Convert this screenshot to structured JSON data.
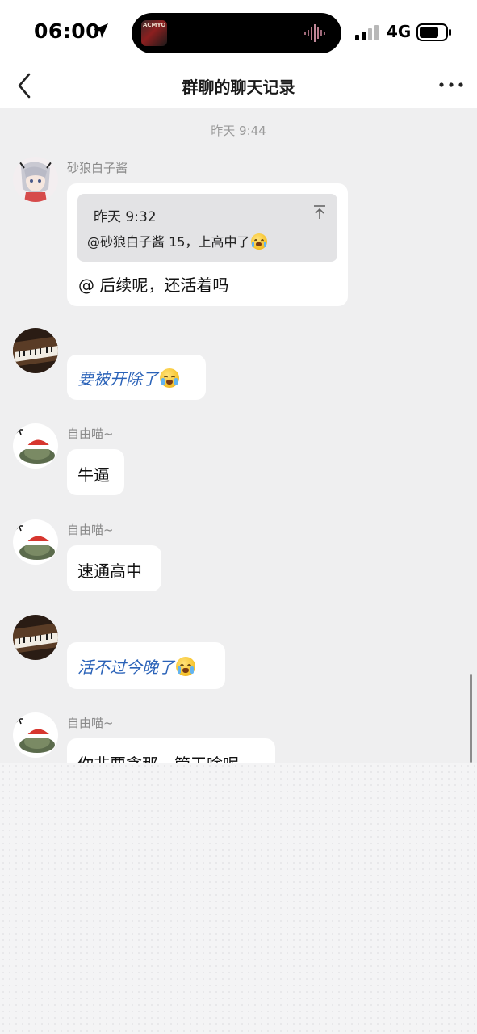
{
  "status_bar": {
    "time": "06:00",
    "network": "4G",
    "island_art_text": "ACMYO"
  },
  "nav": {
    "title": "群聊的聊天记录"
  },
  "chat": {
    "time_divider": "昨天 9:44",
    "messages": [
      {
        "sender": "砂狼白子酱",
        "quote_time": "昨天 9:32",
        "quote_text": "@砂狼白子酱 15，上高中了",
        "text": "@ 后续呢，还活着吗"
      },
      {
        "sender": "",
        "text": "要被开除了"
      },
      {
        "sender": "自由喵~",
        "text": "牛逼"
      },
      {
        "sender": "自由喵~",
        "text": "速通高中"
      },
      {
        "sender": "",
        "text": "活不过今晚了"
      },
      {
        "sender": "自由喵~",
        "text": "你非要贪那一管干啥呢"
      }
    ]
  },
  "colors": {
    "chat_bg": "#efeff0",
    "bubble_bg": "#ffffff",
    "link_blue": "#2a62b8"
  },
  "icons": [
    "location-arrow-icon",
    "waveform-icon",
    "signal-icon",
    "battery-icon",
    "back-chevron-icon",
    "more-dots-icon",
    "pin-top-icon",
    "crying-emoji-icon"
  ]
}
